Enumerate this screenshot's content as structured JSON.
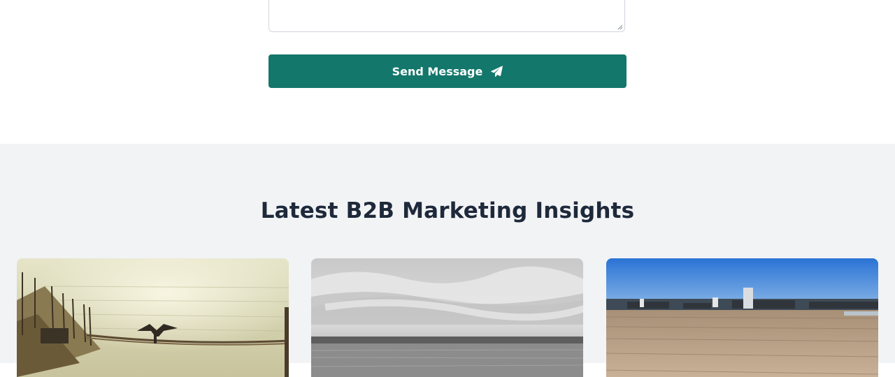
{
  "contact_form": {
    "send_button_label": "Send Message",
    "send_icon": "paper-plane-icon"
  },
  "insights": {
    "title": "Latest B2B Marketing Insights",
    "cards": [
      {
        "image": "pier-with-cormorant-photo"
      },
      {
        "image": "black-and-white-seascape-photo"
      },
      {
        "image": "wooden-dock-photo"
      }
    ]
  },
  "colors": {
    "primary_button": "#13776b",
    "section_background": "#f2f3f5",
    "heading_text": "#1e293b"
  }
}
